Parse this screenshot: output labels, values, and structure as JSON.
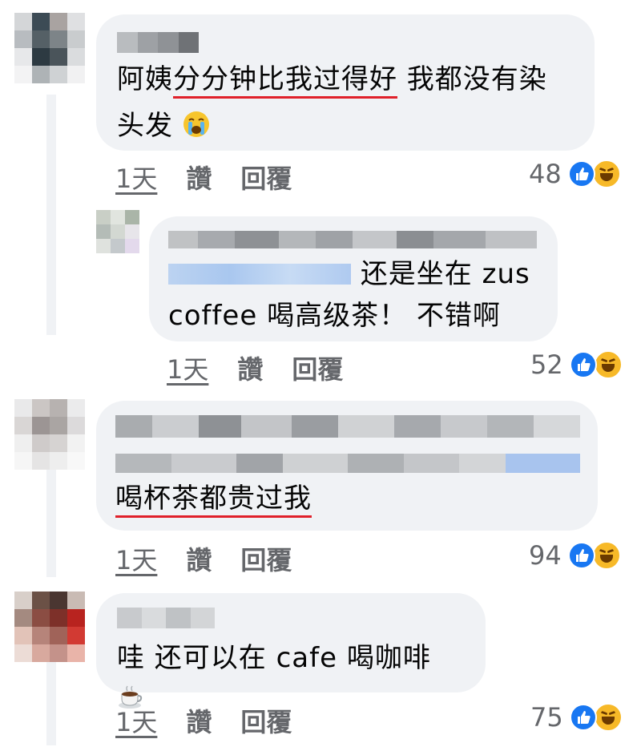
{
  "comments": [
    {
      "text_underlined": "分分钟比我过得好",
      "text_pre": "阿姨",
      "text_post_line1": " 我都没有染",
      "text_line2": "头发",
      "emoji": "loudly-crying-face",
      "time": "1天",
      "like_label": "讚",
      "reply_label": "回覆",
      "reaction_count": "48",
      "reactions": [
        "like-icon",
        "haha-icon"
      ]
    },
    {
      "text_line1": "还是坐在 zus",
      "text_line2": "coffee 喝高级茶！ 不错啊",
      "time": "1天",
      "like_label": "讚",
      "reply_label": "回覆",
      "reaction_count": "52",
      "reactions": [
        "like-icon",
        "haha-icon"
      ]
    },
    {
      "text_underlined": "喝杯茶都贵过我",
      "time": "1天",
      "like_label": "讚",
      "reply_label": "回覆",
      "reaction_count": "94",
      "reactions": [
        "like-icon",
        "haha-icon"
      ]
    },
    {
      "text": "哇 还可以在 cafe 喝咖啡",
      "emoji": "hot-beverage",
      "time": "1天",
      "like_label": "讚",
      "reply_label": "回覆",
      "reaction_count": "75",
      "reactions": [
        "like-icon",
        "haha-icon"
      ]
    }
  ],
  "colors": {
    "bubble": "#f0f2f5",
    "meta_text": "#65676b",
    "underline": "#e0202a",
    "like_blue": "#1877f2",
    "haha_yellow": "#f7b928"
  }
}
